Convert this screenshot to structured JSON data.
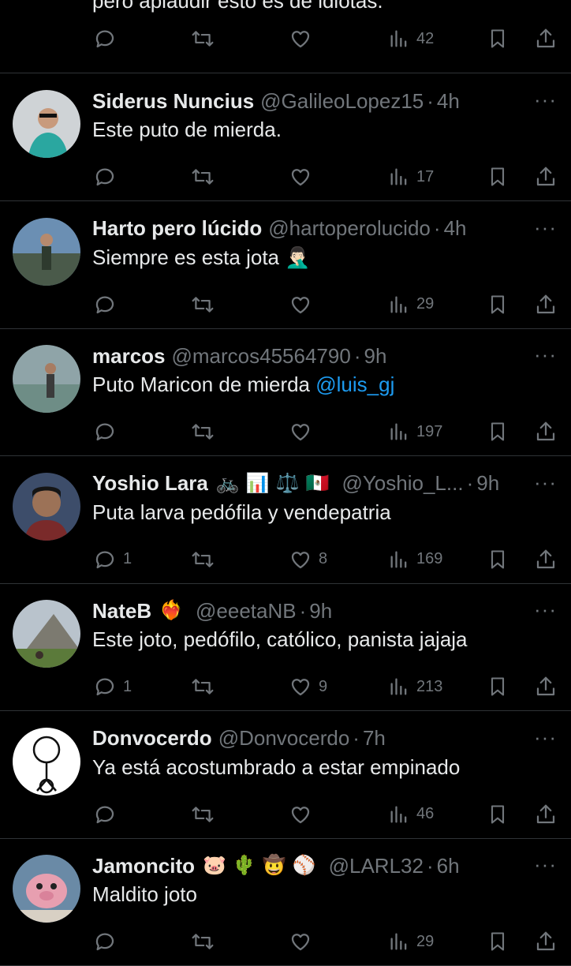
{
  "top_partial": {
    "text": "pero aplaudir esto es de idiotas.",
    "views": "42"
  },
  "icons": {
    "reply": "reply-icon",
    "repost": "repost-icon",
    "like": "heart-icon",
    "views": "views-icon",
    "bookmark": "bookmark-icon",
    "share": "share-icon",
    "more": "more-icon"
  },
  "replies": [
    {
      "name": "Siderus Nuncius",
      "emojis": [],
      "handle": "@GalileoLopez15",
      "time": "4h",
      "text": "Este puto de mierda.",
      "mention": "",
      "replies": "",
      "likes": "",
      "views": "17"
    },
    {
      "name": "Harto pero lúcido",
      "emojis": [],
      "handle": "@hartoperolucido",
      "time": "4h",
      "text": "Siempre es esta jota 🤦🏻‍♂️",
      "mention": "",
      "replies": "",
      "likes": "",
      "views": "29"
    },
    {
      "name": "marcos",
      "emojis": [],
      "handle": "@marcos45564790",
      "time": "9h",
      "text": "Puto Maricon de mierda ",
      "mention": "@luis_gj",
      "replies": "",
      "likes": "",
      "views": "197"
    },
    {
      "name": "Yoshio Lara",
      "emojis": [
        "🚲",
        "📊",
        "⚖️",
        "🇲🇽"
      ],
      "handle": "@Yoshio_L...",
      "time": "9h",
      "text": "Puta larva pedófila y vendepatria",
      "mention": "",
      "replies": "1",
      "likes": "8",
      "views": "169"
    },
    {
      "name": "NateB",
      "emojis": [
        "❤️‍🔥"
      ],
      "handle": "@eeetaNB",
      "time": "9h",
      "text": "Este joto, pedófilo, católico, panista jajaja",
      "mention": "",
      "replies": "1",
      "likes": "9",
      "views": "213"
    },
    {
      "name": "Donvocerdo",
      "emojis": [],
      "handle": "@Donvocerdo",
      "time": "7h",
      "text": "Ya está acostumbrado a estar empinado",
      "mention": "",
      "replies": "",
      "likes": "",
      "views": "46"
    },
    {
      "name": "Jamoncito",
      "emojis": [
        "🐷",
        "🌵",
        "🤠",
        "⚾"
      ],
      "handle": "@LARL32",
      "time": "6h",
      "text": "Maldito joto",
      "mention": "",
      "replies": "",
      "likes": "",
      "views": "29"
    }
  ],
  "colors": {
    "background": "#000000",
    "text": "#e7e9ea",
    "muted": "#71767b",
    "link": "#1d9bf0",
    "divider": "#2f3336"
  }
}
